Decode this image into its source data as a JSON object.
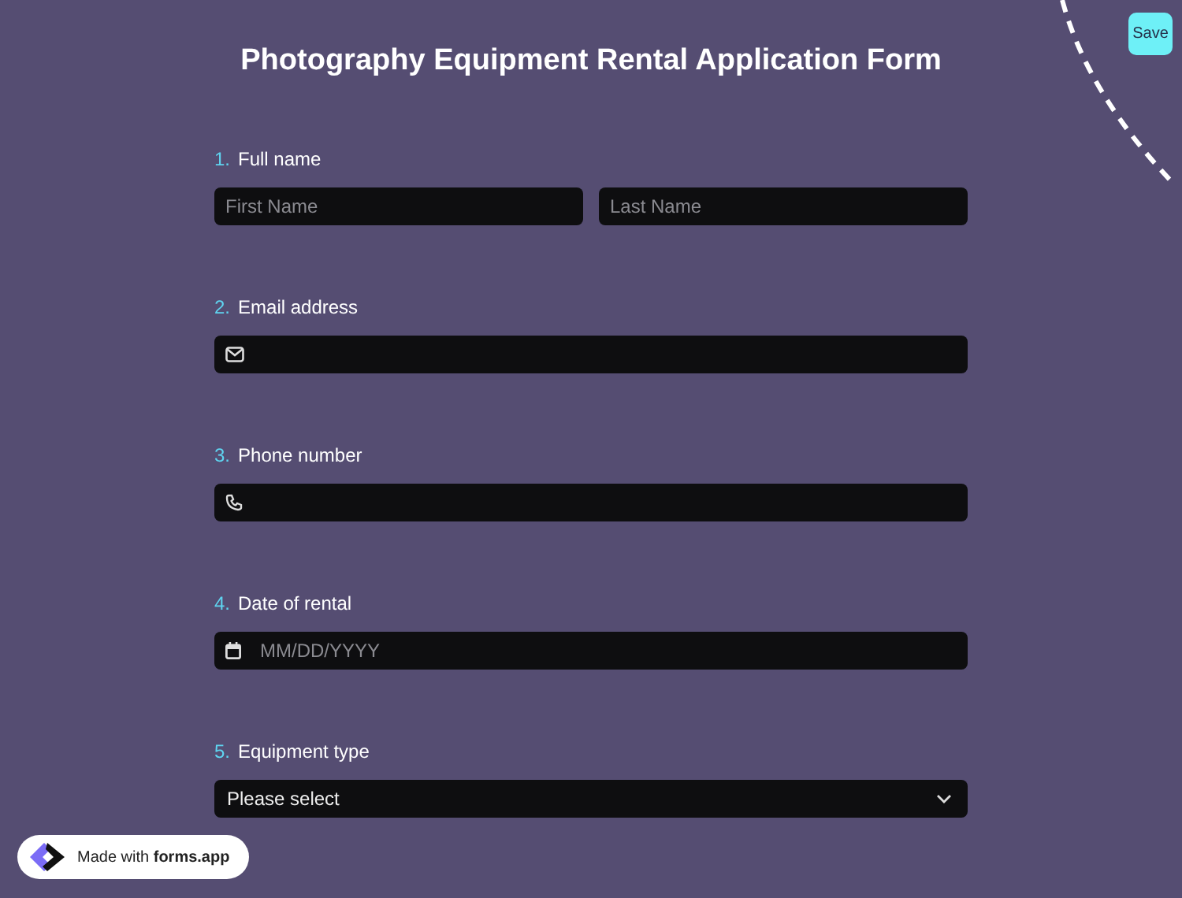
{
  "title": "Photography Equipment Rental Application Form",
  "save_button": "Save",
  "questions": [
    {
      "number": "1.",
      "label": "Full name",
      "kind": "name",
      "placeholders": [
        "First Name",
        "Last Name"
      ]
    },
    {
      "number": "2.",
      "label": "Email address",
      "kind": "email"
    },
    {
      "number": "3.",
      "label": "Phone number",
      "kind": "phone"
    },
    {
      "number": "4.",
      "label": "Date of rental",
      "kind": "date",
      "placeholder": "MM/DD/YYYY"
    },
    {
      "number": "5.",
      "label": "Equipment type",
      "kind": "select",
      "value": "Please select"
    }
  ],
  "badge": {
    "prefix": "Made with",
    "brand": "forms.app"
  }
}
